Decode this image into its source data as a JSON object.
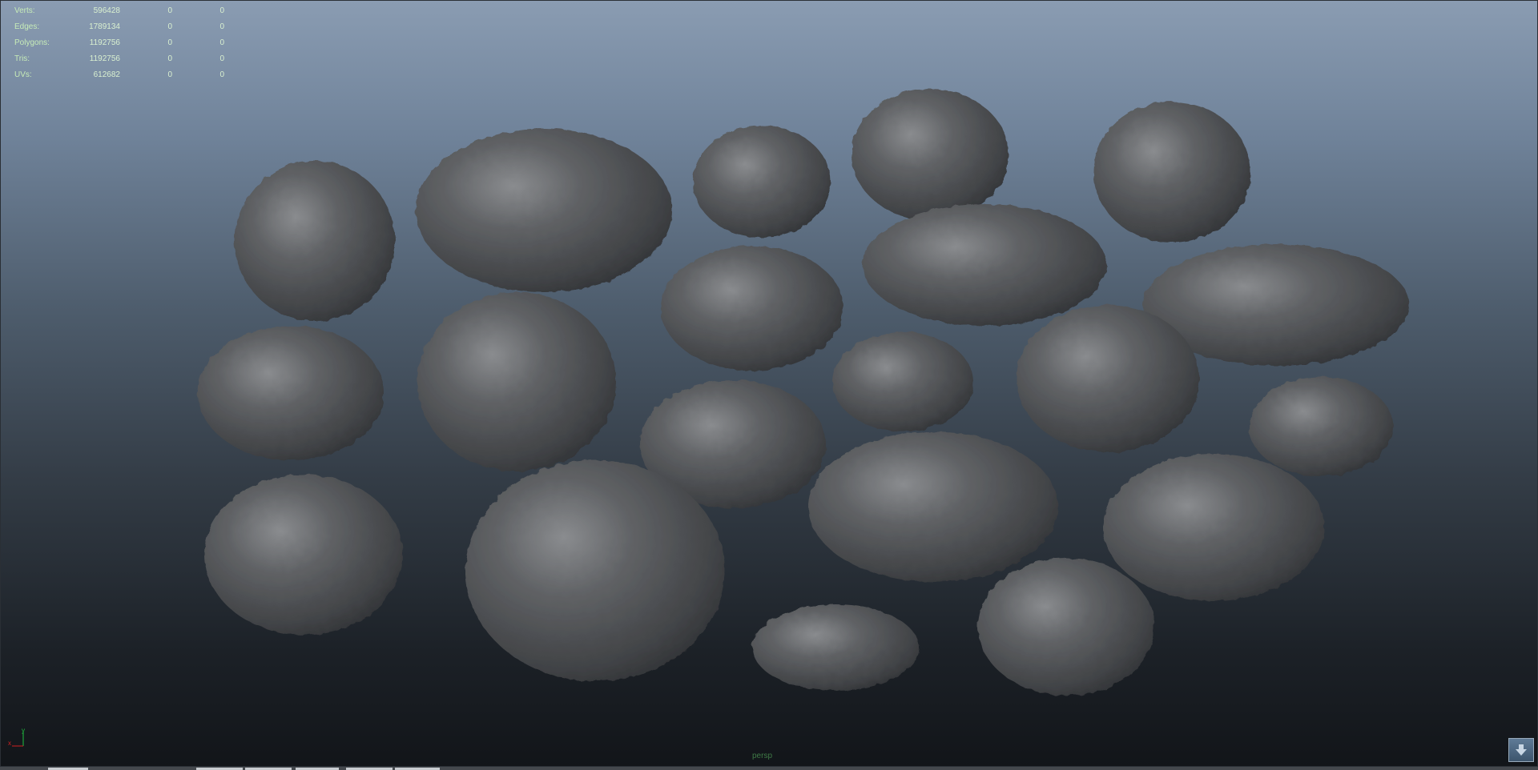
{
  "hud": {
    "rows": [
      {
        "label": "Verts:",
        "v1": "596428",
        "v2": "0",
        "v3": "0"
      },
      {
        "label": "Edges:",
        "v1": "1789134",
        "v2": "0",
        "v3": "0"
      },
      {
        "label": "Polygons:",
        "v1": "1192756",
        "v2": "0",
        "v3": "0"
      },
      {
        "label": "Tris:",
        "v1": "1192756",
        "v2": "0",
        "v3": "0"
      },
      {
        "label": "UVs:",
        "v1": "612682",
        "v2": "0",
        "v3": "0"
      }
    ]
  },
  "viewport": {
    "camera": "persp",
    "axis": {
      "y": "y",
      "x": "x"
    }
  },
  "colors": {
    "hud_text": "#c7ecb8",
    "rock": "#5a5c5f",
    "axis_x": "#d02020",
    "axis_y": "#20c040",
    "camera_label": "#3f7a46"
  },
  "icons": {
    "corner_button": "arrow-down-icon"
  }
}
